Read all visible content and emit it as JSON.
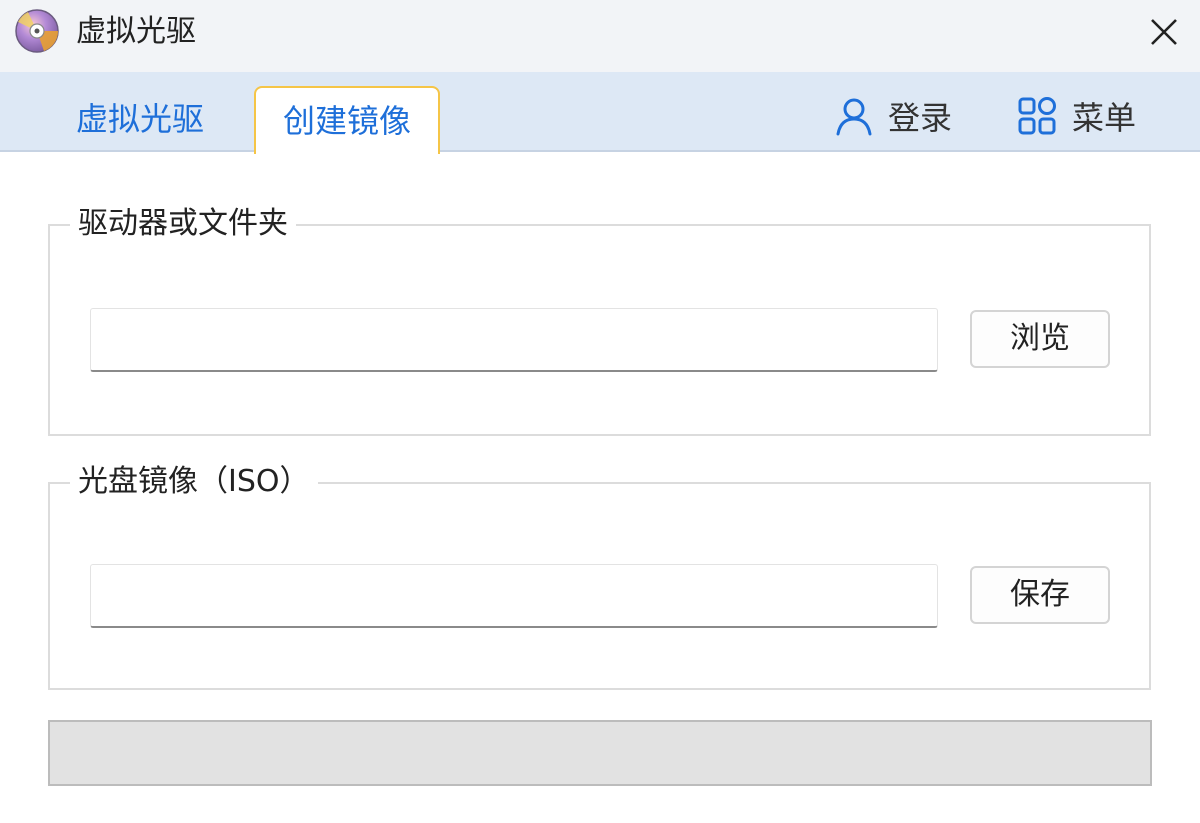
{
  "window": {
    "title": "虚拟光驱",
    "app_icon": "optical-disc-icon",
    "close_icon": "close-icon"
  },
  "tabs": [
    {
      "label": "虚拟光驱",
      "active": false
    },
    {
      "label": "创建镜像",
      "active": true
    }
  ],
  "header_actions": {
    "login": {
      "label": "登录",
      "icon": "user-icon"
    },
    "menu": {
      "label": "菜单",
      "icon": "grid-menu-icon"
    }
  },
  "drive_group": {
    "legend": "驱动器或文件夹",
    "input_value": "",
    "browse_label": "浏览"
  },
  "iso_group": {
    "legend": "光盘镜像（ISO）",
    "input_value": "",
    "save_label": "保存"
  },
  "progress": {
    "value": 0
  },
  "colors": {
    "accent": "#1e6fd9",
    "active_tab_border": "#f5c547",
    "tabbar_bg": "#dde8f5"
  }
}
